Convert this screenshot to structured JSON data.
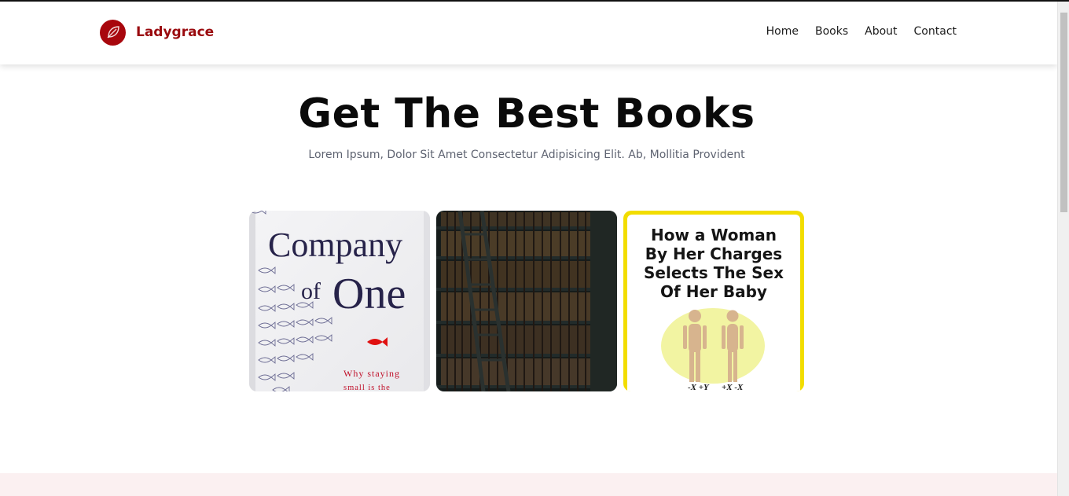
{
  "brand": {
    "name": "Ladygrace",
    "logo_icon": "leaf-icon",
    "color": "#9a0a0e"
  },
  "nav": {
    "items": [
      "Home",
      "Books",
      "About",
      "Contact"
    ]
  },
  "hero": {
    "title": "Get The Best Books",
    "subtitle": "Lorem Ipsum, Dolor Sit Amet Consectetur Adipisicing Elit. Ab, Mollitia Provident"
  },
  "books": [
    {
      "title_line1": "Company",
      "title_line2_small": "of",
      "title_line2": "One",
      "tagline1": "Why staying",
      "tagline2": "small is the"
    },
    {
      "caption": ""
    },
    {
      "line1": "How a Woman",
      "line2": "By Her Charges",
      "line3": "Selects The Sex",
      "line4": "Of Her Baby",
      "label_left": "-X +Y",
      "label_right": "+X -X"
    }
  ],
  "colors": {
    "accent": "#a8070d",
    "footer_band": "#fbf0f1"
  }
}
